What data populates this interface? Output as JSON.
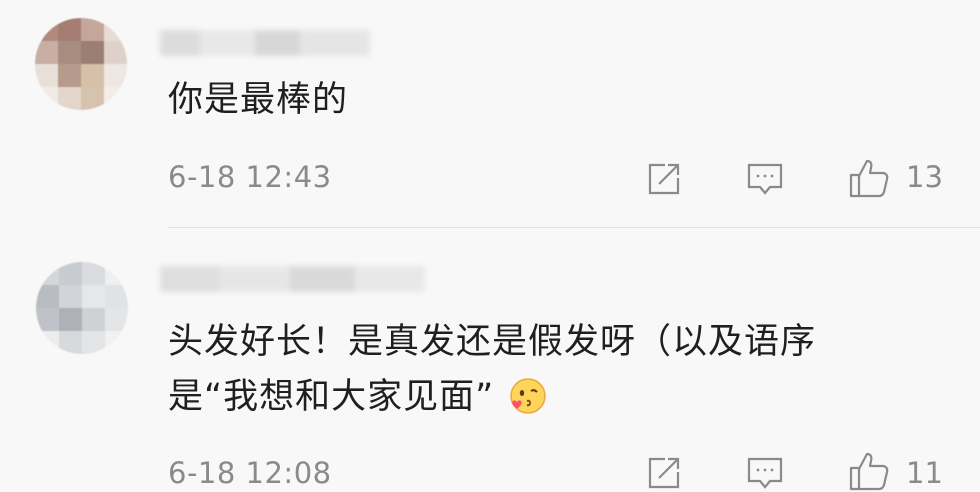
{
  "comments": [
    {
      "text": "你是最棒的",
      "time": "6-18 12:43",
      "likes": "13"
    },
    {
      "text_line1": "头发好长！是真发还是假发呀（以及语序",
      "text_line2": "是“我想和大家见面”",
      "time": "6-18 12:08",
      "likes": "11"
    }
  ],
  "icons": {
    "share": "share-icon",
    "reply": "reply-icon",
    "like": "thumbs-up-icon",
    "emoji": "kiss-emoji-icon"
  },
  "colors": {
    "background": "#f8f8f8",
    "text": "#1f1f1f",
    "meta": "#8a8a8a",
    "divider": "#e4e4e4"
  }
}
